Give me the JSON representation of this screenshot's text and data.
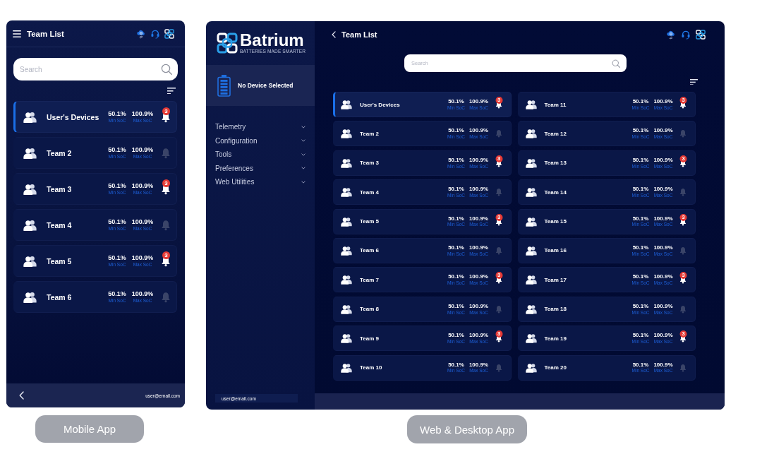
{
  "mobile_app": {
    "header": {
      "title": "Team List"
    },
    "search": {
      "placeholder": "Search"
    },
    "teams": [
      {
        "name": "User's Devices",
        "selected": true,
        "min_soc": "50.1%",
        "min_soc_label": "Min SoC",
        "max_soc": "100.9%",
        "max_soc_label": "Max SoC",
        "alert": true,
        "badge": "3"
      },
      {
        "name": "Team 2",
        "selected": false,
        "min_soc": "50.1%",
        "min_soc_label": "Min SoC",
        "max_soc": "100.9%",
        "max_soc_label": "Max SoC",
        "alert": false
      },
      {
        "name": "Team 3",
        "selected": false,
        "min_soc": "50.1%",
        "min_soc_label": "Min SoC",
        "max_soc": "100.9%",
        "max_soc_label": "Max SoC",
        "alert": true,
        "badge": "3"
      },
      {
        "name": "Team 4",
        "selected": false,
        "min_soc": "50.1%",
        "min_soc_label": "Min SoC",
        "max_soc": "100.9%",
        "max_soc_label": "Max SoC",
        "alert": false
      },
      {
        "name": "Team 5",
        "selected": false,
        "min_soc": "50.1%",
        "min_soc_label": "Min SoC",
        "max_soc": "100.9%",
        "max_soc_label": "Max SoC",
        "alert": true,
        "badge": "3"
      },
      {
        "name": "Team 6",
        "selected": false,
        "min_soc": "50.1%",
        "min_soc_label": "Min SoC",
        "max_soc": "100.9%",
        "max_soc_label": "Max SoC",
        "alert": false
      }
    ],
    "footer": {
      "email": "user@email.com"
    },
    "caption": "Mobile App"
  },
  "desktop_app": {
    "brand": {
      "name": "Batrium",
      "tagline": "BATTERIES MADE SMARTER"
    },
    "device": {
      "status": "No Device Selected"
    },
    "menu": [
      {
        "label": "Telemetry"
      },
      {
        "label": "Configuration"
      },
      {
        "label": "Tools"
      },
      {
        "label": "Preferences"
      },
      {
        "label": "Web Utilities"
      }
    ],
    "user": {
      "email": "user@email.com"
    },
    "header": {
      "title": "Team List"
    },
    "search": {
      "placeholder": "Search"
    },
    "teams": [
      {
        "name": "User's Devices",
        "selected": true,
        "min_soc": "50.1%",
        "min_soc_label": "Min SoC",
        "max_soc": "100.9%",
        "max_soc_label": "Max SoC",
        "alert": true,
        "badge": "3"
      },
      {
        "name": "Team 2",
        "selected": false,
        "min_soc": "50.1%",
        "min_soc_label": "Min SoC",
        "max_soc": "100.9%",
        "max_soc_label": "Max SoC",
        "alert": false
      },
      {
        "name": "Team 3",
        "selected": false,
        "min_soc": "50.1%",
        "min_soc_label": "Min SoC",
        "max_soc": "100.9%",
        "max_soc_label": "Max SoC",
        "alert": true,
        "badge": "3"
      },
      {
        "name": "Team 4",
        "selected": false,
        "min_soc": "50.1%",
        "min_soc_label": "Min SoC",
        "max_soc": "100.9%",
        "max_soc_label": "Max SoC",
        "alert": false
      },
      {
        "name": "Team 5",
        "selected": false,
        "min_soc": "50.1%",
        "min_soc_label": "Min SoC",
        "max_soc": "100.9%",
        "max_soc_label": "Max SoC",
        "alert": true,
        "badge": "3"
      },
      {
        "name": "Team 6",
        "selected": false,
        "min_soc": "50.1%",
        "min_soc_label": "Min SoC",
        "max_soc": "100.9%",
        "max_soc_label": "Max SoC",
        "alert": false
      },
      {
        "name": "Team 7",
        "selected": false,
        "min_soc": "50.1%",
        "min_soc_label": "Min SoC",
        "max_soc": "100.9%",
        "max_soc_label": "Max SoC",
        "alert": true,
        "badge": "3"
      },
      {
        "name": "Team 8",
        "selected": false,
        "min_soc": "50.1%",
        "min_soc_label": "Min SoC",
        "max_soc": "100.9%",
        "max_soc_label": "Max SoC",
        "alert": false
      },
      {
        "name": "Team 9",
        "selected": false,
        "min_soc": "50.1%",
        "min_soc_label": "Min SoC",
        "max_soc": "100.9%",
        "max_soc_label": "Max SoC",
        "alert": true,
        "badge": "3"
      },
      {
        "name": "Team 10",
        "selected": false,
        "min_soc": "50.1%",
        "min_soc_label": "Min SoC",
        "max_soc": "100.9%",
        "max_soc_label": "Max SoC",
        "alert": false
      },
      {
        "name": "Team 11",
        "selected": false,
        "min_soc": "50.1%",
        "min_soc_label": "Min SoC",
        "max_soc": "100.9%",
        "max_soc_label": "Max SoC",
        "alert": true,
        "badge": "3"
      },
      {
        "name": "Team 12",
        "selected": false,
        "min_soc": "50.1%",
        "min_soc_label": "Min SoC",
        "max_soc": "100.9%",
        "max_soc_label": "Max SoC",
        "alert": false
      },
      {
        "name": "Team 13",
        "selected": false,
        "min_soc": "50.1%",
        "min_soc_label": "Min SoC",
        "max_soc": "100.9%",
        "max_soc_label": "Max SoC",
        "alert": true,
        "badge": "3"
      },
      {
        "name": "Team 14",
        "selected": false,
        "min_soc": "50.1%",
        "min_soc_label": "Min SoC",
        "max_soc": "100.9%",
        "max_soc_label": "Max SoC",
        "alert": false
      },
      {
        "name": "Team 15",
        "selected": false,
        "min_soc": "50.1%",
        "min_soc_label": "Min SoC",
        "max_soc": "100.9%",
        "max_soc_label": "Max SoC",
        "alert": true,
        "badge": "3"
      },
      {
        "name": "Team 16",
        "selected": false,
        "min_soc": "50.1%",
        "min_soc_label": "Min SoC",
        "max_soc": "100.9%",
        "max_soc_label": "Max SoC",
        "alert": false
      },
      {
        "name": "Team 17",
        "selected": false,
        "min_soc": "50.1%",
        "min_soc_label": "Min SoC",
        "max_soc": "100.9%",
        "max_soc_label": "Max SoC",
        "alert": true,
        "badge": "3"
      },
      {
        "name": "Team 18",
        "selected": false,
        "min_soc": "50.1%",
        "min_soc_label": "Min SoC",
        "max_soc": "100.9%",
        "max_soc_label": "Max SoC",
        "alert": false
      },
      {
        "name": "Team 19",
        "selected": false,
        "min_soc": "50.1%",
        "min_soc_label": "Min SoC",
        "max_soc": "100.9%",
        "max_soc_label": "Max SoC",
        "alert": true,
        "badge": "3"
      },
      {
        "name": "Team 20",
        "selected": false,
        "min_soc": "50.1%",
        "min_soc_label": "Min SoC",
        "max_soc": "100.9%",
        "max_soc_label": "Max SoC",
        "alert": false
      }
    ],
    "caption": "Web & Desktop App"
  }
}
